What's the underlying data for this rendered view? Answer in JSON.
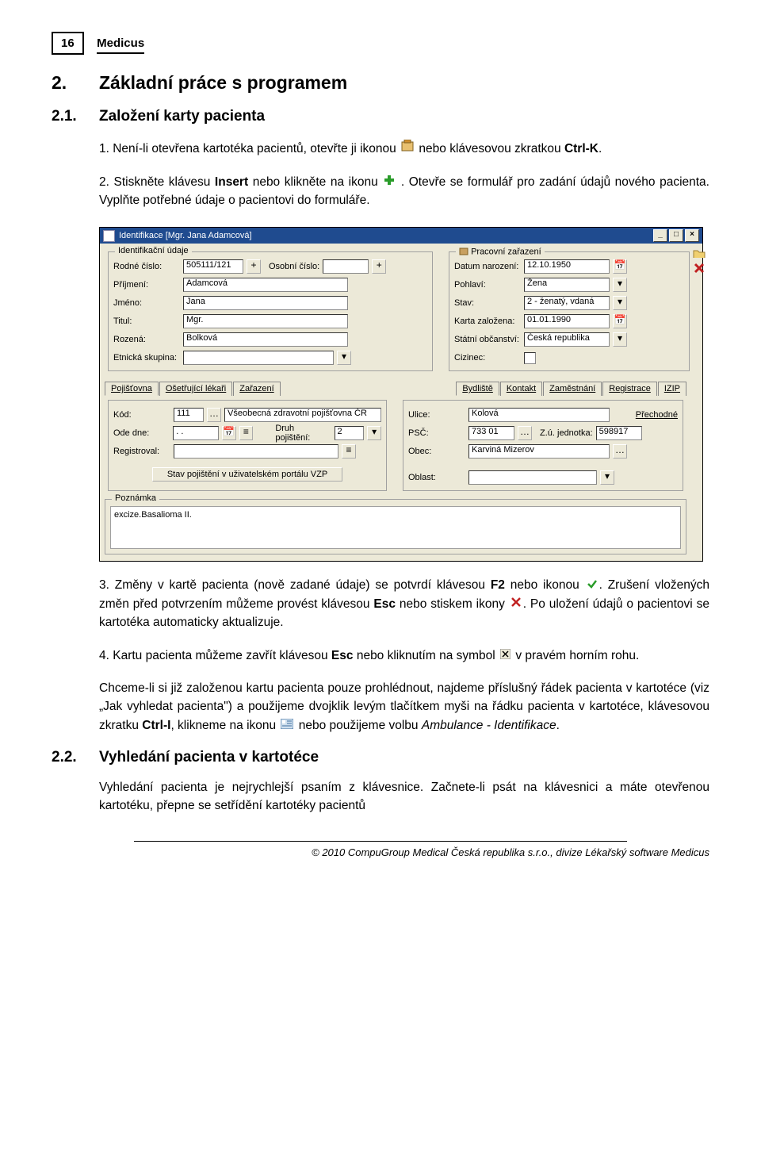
{
  "page_number": "16",
  "app_name": "Medicus",
  "h1_num": "2.",
  "h1_text": "Základní práce s programem",
  "h21_num": "2.1.",
  "h21_text": "Založení karty pacienta",
  "list1": {
    "p1a": "1. Není-li otevřena kartotéka pacientů, otevřte ji ikonou ",
    "p1b": " nebo klávesovou zkratkou ",
    "p1bold": "Ctrl-K",
    "p1end": ".",
    "p2a": "2. Stiskněte klávesu ",
    "p2bold": "Insert",
    "p2b": " nebo klikněte na ikonu ",
    "p2c": ". Otevře se formulář pro zadání údajů nového pacienta. Vyplňte potřebné údaje o pacientovi do formuláře.",
    "p3a": "3. Změny v kartě pacienta (nově zadané údaje) se potvrdí klávesou ",
    "p3bold1": "F2",
    "p3b": " nebo ikonou ",
    "p3c": ". Zrušení vložených změn před potvrzením můžeme provést klávesou ",
    "p3bold2": "Esc",
    "p3d": " nebo stiskem ikony ",
    "p3e": ". Po uložení údajů o pacientovi se kartotéka automaticky aktualizuje.",
    "p4a": "4. Kartu pacienta můžeme zavřít klávesou ",
    "p4bold": "Esc",
    "p4b": " nebo kliknutím na symbol ",
    "p4c": " v pravém horním rohu."
  },
  "para2": {
    "a": "Chceme-li si již založenou kartu pacienta pouze prohlédnout, najdeme příslušný řádek pacienta v kartotéce (viz „Jak vyhledat pacienta\") a použijeme dvojklik levým tlačítkem myši na řádku pacienta v kartotéce, klávesovou zkratku ",
    "bold": "Ctrl-I",
    "b": ", klikneme na ikonu ",
    "c": " nebo použijeme volbu ",
    "italic": "Ambulance - Identifikace",
    "end": "."
  },
  "h22_num": "2.2.",
  "h22_text": "Vyhledání pacienta v kartotéce",
  "body22": "Vyhledání pacienta je nejrychlejší psaním z klávesnice. Začnete-li psát na klávesnici a máte otevřenou kartotéku, přepne se setřídění kartotéky pacientů",
  "footer": "© 2010 CompuGroup Medical Česká republika s.r.o., divize Lékařský software Medicus",
  "form": {
    "title": "Identifikace [Mgr. Jana Adamcová]",
    "group_id": "Identifikační údaje",
    "group_prac": "Pracovní zařazení",
    "rodne": "Rodné číslo:",
    "rodne_v": "505111/121",
    "osobni": "Osobní číslo:",
    "prijmeni": "Příjmení:",
    "prijmeni_v": "Adamcová",
    "jmeno": "Jméno:",
    "jmeno_v": "Jana",
    "titul": "Titul:",
    "titul_v": "Mgr.",
    "rozena": "Rozená:",
    "rozena_v": "Bolková",
    "etnic": "Etnická skupina:",
    "datum": "Datum narození:",
    "datum_v": "12.10.1950",
    "pohlavi": "Pohlaví:",
    "pohlavi_v": "Žena",
    "stav": "Stav:",
    "stav_v": "2 - ženatý, vdaná",
    "karta": "Karta založena:",
    "karta_v": "01.01.1990",
    "statni": "Státní občanství:",
    "statni_v": "Česká republika",
    "cizinec": "Cizinec:",
    "tabs_left": {
      "pojist": "Pojišťovna",
      "lekari": "Ošetřující lékaři",
      "zaraz": "Zařazení"
    },
    "tabs_right": {
      "bydl": "Bydliště",
      "kontakt": "Kontakt",
      "zamest": "Zaměstnání",
      "registr": "Registrace",
      "izip": "IZIP"
    },
    "kod": "Kód:",
    "kod_v": "111",
    "kod_name": "Všeobecná zdravotní pojišťovna ČR",
    "ode": "Ode dne:",
    "ode_v": ". .",
    "druh": "Druh pojištění:",
    "druh_v": "2",
    "registroval": "Registroval:",
    "stav_portal": "Stav pojištění v uživatelském portálu VZP",
    "ulice": "Ulice:",
    "ulice_v": "Kolová",
    "prechodne": "Přechodné",
    "psc": "PSČ:",
    "psc_v": "733 01",
    "zuj": "Z.ú. jednotka:",
    "zuj_v": "598917",
    "obec": "Obec:",
    "obec_v": "Karviná Mizerov",
    "oblast": "Oblast:",
    "poznamka": "Poznámka",
    "poznamka_v": "excize.Basalioma II."
  }
}
